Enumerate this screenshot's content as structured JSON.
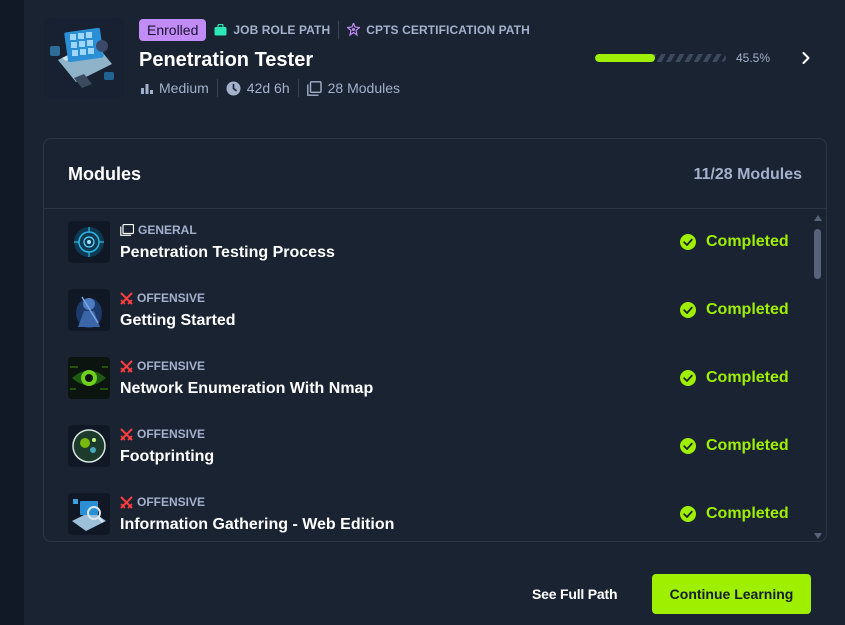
{
  "path": {
    "badge": "Enrolled",
    "tags": [
      {
        "label": "JOB ROLE PATH",
        "icon": "briefcase-icon"
      },
      {
        "label": "CPTS CERTIFICATION PATH",
        "icon": "certification-icon"
      }
    ],
    "title": "Penetration Tester",
    "difficulty": "Medium",
    "duration": "42d 6h",
    "modules_total": "28 Modules",
    "progress_text": "45.5%",
    "progress_value": 45.5
  },
  "modules": {
    "title": "Modules",
    "count": "11/28 Modules",
    "items": [
      {
        "category": "GENERAL",
        "category_icon": "book-icon",
        "name": "Penetration Testing Process",
        "status": "Completed"
      },
      {
        "category": "OFFENSIVE",
        "category_icon": "swords-icon",
        "name": "Getting Started",
        "status": "Completed"
      },
      {
        "category": "OFFENSIVE",
        "category_icon": "swords-icon",
        "name": "Network Enumeration With Nmap",
        "status": "Completed"
      },
      {
        "category": "OFFENSIVE",
        "category_icon": "swords-icon",
        "name": "Footprinting",
        "status": "Completed"
      },
      {
        "category": "OFFENSIVE",
        "category_icon": "swords-icon",
        "name": "Information Gathering - Web Edition",
        "status": "Completed"
      }
    ]
  },
  "footer": {
    "see_full_path": "See Full Path",
    "continue": "Continue Learning"
  },
  "colors": {
    "background": "#141d2b",
    "panel": "#1a2332",
    "accent_green": "#9fef00",
    "enrolled_purple": "#c28cf7",
    "muted_text": "#a4b1cd",
    "offensive_red": "#ff3e3e",
    "job_role_green": "#2ee7b6"
  }
}
